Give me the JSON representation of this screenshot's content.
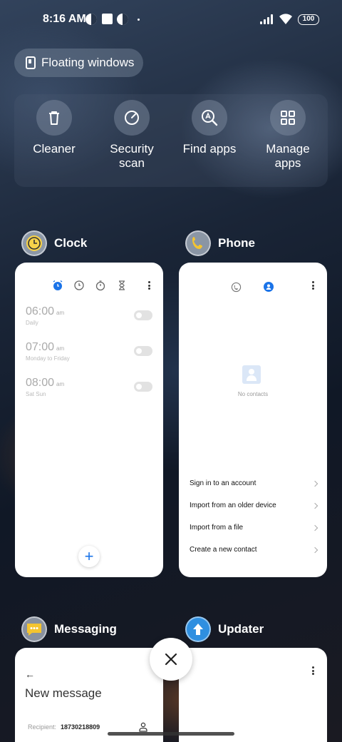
{
  "status_bar": {
    "time": "8:16 AM",
    "battery": "100"
  },
  "floating_windows": {
    "label": "Floating windows"
  },
  "quick_actions": [
    {
      "label": "Cleaner",
      "icon": "trash-icon"
    },
    {
      "label": "Security scan",
      "icon": "speed-gauge-icon"
    },
    {
      "label": "Find apps",
      "icon": "search-app-icon"
    },
    {
      "label": "Manage apps",
      "icon": "grid-icon"
    }
  ],
  "apps": {
    "clock": {
      "name": "Clock",
      "alarms": [
        {
          "time": "06:00",
          "ampm": "am",
          "days": "Daily"
        },
        {
          "time": "07:00",
          "ampm": "am",
          "days": "Monday to Friday"
        },
        {
          "time": "08:00",
          "ampm": "am",
          "days": "Sat Sun"
        }
      ]
    },
    "phone": {
      "name": "Phone",
      "empty_text": "No contacts",
      "options": [
        "Sign in to an account",
        "Import from an older device",
        "Import from a file",
        "Create a new contact"
      ]
    },
    "messaging": {
      "name": "Messaging",
      "title": "New message",
      "recipient_label": "Recipient:",
      "recipient_value": "18730218809"
    },
    "updater": {
      "name": "Updater"
    }
  },
  "colors": {
    "accent": "#1a73e8"
  }
}
